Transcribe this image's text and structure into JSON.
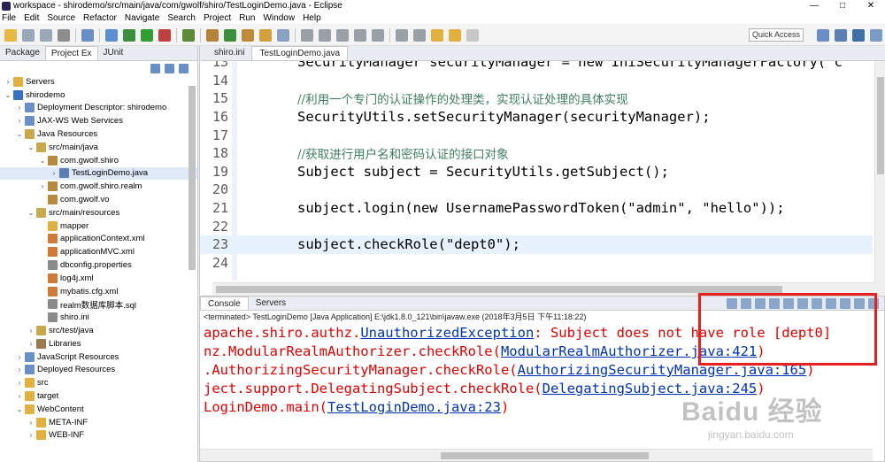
{
  "window": {
    "title": "workspace - shirodemo/src/main/java/com/gwolf/shiro/TestLoginDemo.java - Eclipse",
    "controls": [
      "—",
      "□",
      "✕"
    ]
  },
  "menu": [
    "File",
    "Edit",
    "Source",
    "Refactor",
    "Navigate",
    "Search",
    "Project",
    "Run",
    "Window",
    "Help"
  ],
  "toolbar": {
    "quick_access": "Quick Access"
  },
  "left_panel": {
    "tabs": [
      "Package",
      "Project Ex",
      "JUnit"
    ],
    "tree": [
      {
        "label": "Servers",
        "indent": 0,
        "arrow": "›",
        "icon": "#e0b040"
      },
      {
        "label": "shirodemo",
        "indent": 0,
        "arrow": "⌄",
        "icon": "#3a6fc4"
      },
      {
        "label": "Deployment Descriptor: shirodemo",
        "indent": 1,
        "arrow": "›",
        "icon": "#6a8fc7"
      },
      {
        "label": "JAX-WS Web Services",
        "indent": 1,
        "arrow": "›",
        "icon": "#6a8fc7"
      },
      {
        "label": "Java Resources",
        "indent": 1,
        "arrow": "⌄",
        "icon": "#c8a84a"
      },
      {
        "label": "src/main/java",
        "indent": 2,
        "arrow": "⌄",
        "icon": "#c8a84a"
      },
      {
        "label": "com.gwolf.shiro",
        "indent": 3,
        "arrow": "⌄",
        "icon": "#b88a40"
      },
      {
        "label": "TestLoginDemo.java",
        "indent": 4,
        "arrow": "›",
        "icon": "#5d7fb5",
        "selected": true
      },
      {
        "label": "com.gwolf.shiro.realm",
        "indent": 3,
        "arrow": "›",
        "icon": "#b88a40"
      },
      {
        "label": "com.gwolf.vo",
        "indent": 3,
        "arrow": "",
        "icon": "#b88a40"
      },
      {
        "label": "src/main/resources",
        "indent": 2,
        "arrow": "⌄",
        "icon": "#c8a84a"
      },
      {
        "label": "mapper",
        "indent": 3,
        "arrow": "",
        "icon": "#e0b040"
      },
      {
        "label": "applicationContext.xml",
        "indent": 3,
        "arrow": "",
        "icon": "#d07a3a"
      },
      {
        "label": "applicationMVC.xml",
        "indent": 3,
        "arrow": "",
        "icon": "#d07a3a"
      },
      {
        "label": "dbconfig.properties",
        "indent": 3,
        "arrow": "",
        "icon": "#8a8a8a"
      },
      {
        "label": "log4j.xml",
        "indent": 3,
        "arrow": "",
        "icon": "#d07a3a"
      },
      {
        "label": "mybatis.cfg.xml",
        "indent": 3,
        "arrow": "",
        "icon": "#d07a3a"
      },
      {
        "label": "realm数据库脚本.sql",
        "indent": 3,
        "arrow": "",
        "icon": "#8a8a8a"
      },
      {
        "label": "shiro.ini",
        "indent": 3,
        "arrow": "",
        "icon": "#8a8a8a"
      },
      {
        "label": "src/test/java",
        "indent": 2,
        "arrow": "›",
        "icon": "#c8a84a"
      },
      {
        "label": "Libraries",
        "indent": 2,
        "arrow": "›",
        "icon": "#9a7a50"
      },
      {
        "label": "JavaScript Resources",
        "indent": 1,
        "arrow": "›",
        "icon": "#6a8fc7"
      },
      {
        "label": "Deployed Resources",
        "indent": 1,
        "arrow": "›",
        "icon": "#6a8fc7"
      },
      {
        "label": "src",
        "indent": 1,
        "arrow": "›",
        "icon": "#e0b040"
      },
      {
        "label": "target",
        "indent": 1,
        "arrow": "›",
        "icon": "#e0b040"
      },
      {
        "label": "WebContent",
        "indent": 1,
        "arrow": "⌄",
        "icon": "#e0b040"
      },
      {
        "label": "META-INF",
        "indent": 2,
        "arrow": "›",
        "icon": "#e0b040"
      },
      {
        "label": "WEB-INF",
        "indent": 2,
        "arrow": "›",
        "icon": "#e0b040"
      }
    ]
  },
  "editor": {
    "tabs": [
      "shiro.ini",
      "TestLoginDemo.java"
    ],
    "lines": [
      {
        "num": "13",
        "text": "SecurityManager securityManager = new IniSecurityManagerFactory(\"c",
        "type": "code"
      },
      {
        "num": "14",
        "text": "",
        "type": "code"
      },
      {
        "num": "15",
        "text": "//利用一个专门的认证操作的处理类，实现认证处理的具体实现",
        "type": "comment"
      },
      {
        "num": "16",
        "text": "SecurityUtils.setSecurityManager(securityManager);",
        "type": "code"
      },
      {
        "num": "17",
        "text": "",
        "type": "code"
      },
      {
        "num": "18",
        "text": "//获取进行用户名和密码认证的接口对象",
        "type": "comment"
      },
      {
        "num": "19",
        "text": "Subject subject = SecurityUtils.getSubject();",
        "type": "code"
      },
      {
        "num": "20",
        "text": "",
        "type": "code"
      },
      {
        "num": "21",
        "text": "subject.login(new UsernamePasswordToken(\"admin\", \"hello\"));",
        "type": "code"
      },
      {
        "num": "22",
        "text": "",
        "type": "code"
      },
      {
        "num": "23",
        "text": "subject.checkRole(\"dept0\");",
        "type": "code",
        "highlight": true
      },
      {
        "num": "24",
        "text": "",
        "type": "code"
      }
    ]
  },
  "console": {
    "tabs": [
      "Console",
      "Servers"
    ],
    "status": "<terminated> TestLoginDemo [Java Application] E:\\jdk1.8.0_121\\bin\\javaw.exe (2018年3月5日 下午11:18:22)",
    "lines": [
      {
        "prefix": "apache.shiro.authz.",
        "link": "UnauthorizedException",
        "suffix": ": Subject does not have role [dept0]"
      },
      {
        "prefix": "nz.ModularRealmAuthorizer.checkRole(",
        "link": "ModularRealmAuthorizer.java:421",
        "suffix": ")"
      },
      {
        "prefix": ".AuthorizingSecurityManager.checkRole(",
        "link": "AuthorizingSecurityManager.java:165",
        "suffix": ")"
      },
      {
        "prefix": "ject.support.DelegatingSubject.checkRole(",
        "link": "DelegatingSubject.java:245",
        "suffix": ")"
      },
      {
        "prefix": "LoginDemo.main(",
        "link": "TestLoginDemo.java:23",
        "suffix": ")"
      }
    ]
  },
  "watermark": {
    "main": "Baidu 经验",
    "sub": "jingyan.baidu.com"
  },
  "colors": {
    "error": "#e00000",
    "link": "#0033b3",
    "comment": "#3f7f5f",
    "highlight_box": "#e82020"
  }
}
